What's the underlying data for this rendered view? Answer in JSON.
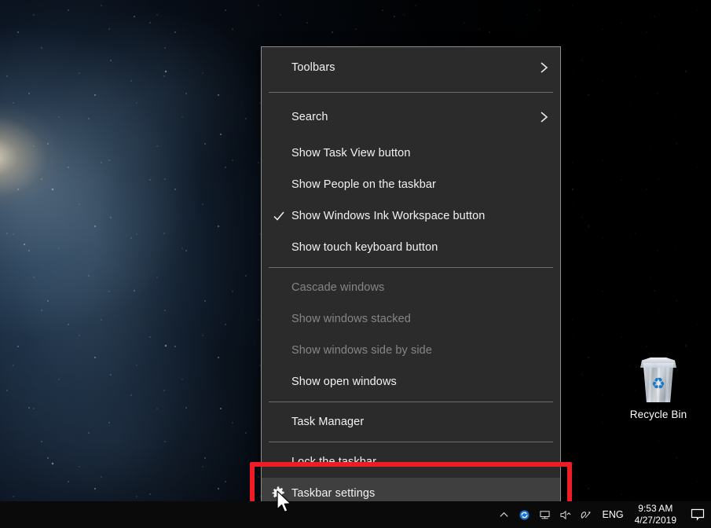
{
  "desktop": {
    "wallpaper_description": "galaxy nebula",
    "icons": [
      {
        "name": "recycle-bin",
        "label": "Recycle Bin",
        "glyph": "recycle-bin-icon"
      }
    ]
  },
  "context_menu": {
    "name": "taskbar-context-menu",
    "background_color": "#2b2b2b",
    "border_color": "#8d8d8d",
    "selected_color": "#3f3f3f",
    "items": [
      {
        "label": "Toolbars",
        "type": "submenu",
        "icon": "chevron-right-icon",
        "disabled": false,
        "checked": false,
        "selected": false
      },
      {
        "label": "Search",
        "type": "submenu",
        "icon": "chevron-right-icon",
        "disabled": false,
        "checked": false,
        "selected": false
      },
      {
        "label": "Show Task View button",
        "type": "toggle",
        "icon": "",
        "disabled": false,
        "checked": false,
        "selected": false
      },
      {
        "label": "Show People on the taskbar",
        "type": "toggle",
        "icon": "",
        "disabled": false,
        "checked": false,
        "selected": false
      },
      {
        "label": "Show Windows Ink Workspace button",
        "type": "toggle",
        "icon": "check-icon",
        "disabled": false,
        "checked": true,
        "selected": false
      },
      {
        "label": "Show touch keyboard button",
        "type": "toggle",
        "icon": "",
        "disabled": false,
        "checked": false,
        "selected": false
      },
      {
        "label": "Cascade windows",
        "type": "command",
        "icon": "",
        "disabled": true,
        "checked": false,
        "selected": false
      },
      {
        "label": "Show windows stacked",
        "type": "command",
        "icon": "",
        "disabled": true,
        "checked": false,
        "selected": false
      },
      {
        "label": "Show windows side by side",
        "type": "command",
        "icon": "",
        "disabled": true,
        "checked": false,
        "selected": false
      },
      {
        "label": "Show open windows",
        "type": "command",
        "icon": "",
        "disabled": false,
        "checked": false,
        "selected": false
      },
      {
        "label": "Task Manager",
        "type": "command",
        "icon": "",
        "disabled": false,
        "checked": false,
        "selected": false
      },
      {
        "label": "Lock the taskbar",
        "type": "toggle",
        "icon": "",
        "disabled": false,
        "checked": false,
        "selected": false
      },
      {
        "label": "Taskbar settings",
        "type": "command",
        "icon": "gear-icon",
        "disabled": false,
        "checked": false,
        "selected": true
      }
    ]
  },
  "annotation": {
    "name": "red-highlight-rectangle",
    "color": "#ee1c26",
    "target_label": "Taskbar settings"
  },
  "taskbar": {
    "background_color": "#0a0a0a",
    "tray_icons": [
      {
        "name": "show-hidden-icons-icon",
        "glyph": "chevron-up"
      },
      {
        "name": "onedrive-sync-icon",
        "glyph": "sync"
      },
      {
        "name": "network-icon",
        "glyph": "network"
      },
      {
        "name": "volume-icon",
        "glyph": "volume"
      },
      {
        "name": "windows-ink-icon",
        "glyph": "pen"
      }
    ],
    "language": "ENG",
    "clock": {
      "time": "9:53 AM",
      "date": "4/27/2019"
    },
    "action_center": {
      "name": "action-center-icon",
      "glyph": "speech-bubble"
    }
  }
}
